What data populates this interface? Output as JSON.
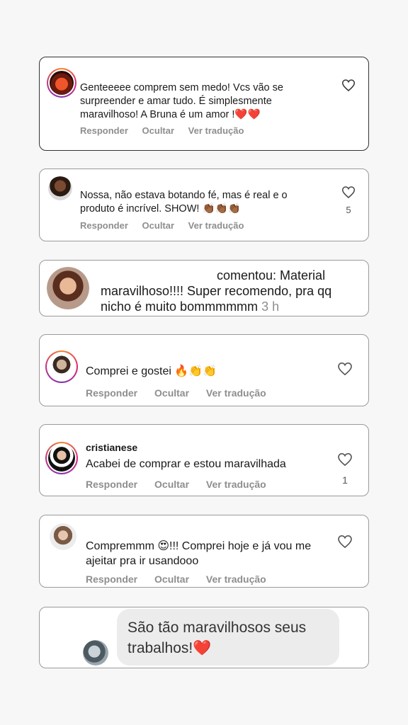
{
  "comments": [
    {
      "text": "Genteeeee comprem sem medo! Vcs vão se surpreender e amar tudo. É simplesmente maravilhoso! A Bruna é um amor !❤️❤️",
      "actions": {
        "reply": "Responder",
        "hide": "Ocultar",
        "translate": "Ver tradução"
      }
    },
    {
      "text": "Nossa, não estava botando fé,  mas é real e o produto é incrível. SHOW! 👏🏾👏🏾👏🏾",
      "likes": "5",
      "actions": {
        "reply": "Responder",
        "hide": "Ocultar",
        "translate": "Ver tradução"
      }
    },
    {
      "text_line1": "comentou: Material",
      "text_line2": "maravilhoso!!!! Super recomendo,  pra qq",
      "text_line3": "nicho é muito bommmmmm",
      "time": "3 h"
    },
    {
      "text": "Comprei e gostei 🔥👏👏",
      "actions": {
        "reply": "Responder",
        "hide": "Ocultar",
        "translate": "Ver tradução"
      }
    },
    {
      "username": "cristianese",
      "text": "Acabei de comprar e estou maravilhada",
      "likes": "1",
      "actions": {
        "reply": "Responder",
        "hide": "Ocultar",
        "translate": "Ver tradução"
      }
    },
    {
      "text": "Comprem­mm 😍!!! Comprei hoje e já vou me ajeitar pra ir usandooo",
      "actions": {
        "reply": "Responder",
        "hide": "Ocultar",
        "translate": "Ver tradução"
      }
    },
    {
      "text": "São tão maravilhosos seus trabalhos!❤️"
    }
  ],
  "colors": {
    "border": "#9a9a9a",
    "muted": "#8e8e8e",
    "bubble": "#ececec"
  }
}
